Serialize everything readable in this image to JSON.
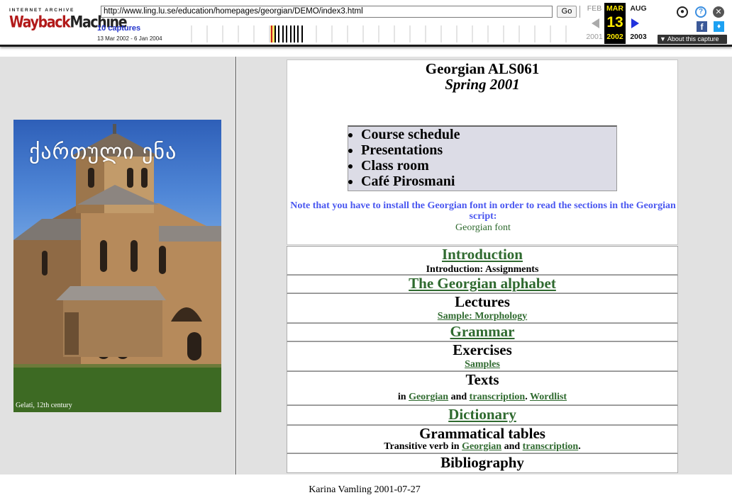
{
  "wayback": {
    "logo_top": "INTERNET ARCHIVE",
    "logo_way": "Wayback",
    "logo_machine": "Machine",
    "url": "http://www.ling.lu.se/education/homepages/georgian/DEMO/index3.html",
    "go_label": "Go",
    "captures": "10 captures",
    "range": "13 Mar 2002 - 6 Jan 2004",
    "months": {
      "prev": {
        "name": "FEB",
        "year": "2001"
      },
      "current": {
        "name": "MAR",
        "day": "13",
        "year": "2002"
      },
      "next": {
        "name": "AUG",
        "year": "2003"
      }
    },
    "about_label": "About this capture",
    "colors": {
      "current_bg": "#000000",
      "current_fg": "#ffea00",
      "captures_link": "#2233cc"
    }
  },
  "left_panel": {
    "image_title": "ქართული ენა",
    "image_caption": "Gelati, 12th century"
  },
  "header": {
    "title": "Georgian ALS061",
    "term": "Spring 2001",
    "menu": [
      "Course schedule",
      "Presentations",
      "Class room",
      "Café Pirosmani"
    ],
    "note": "Note that you have to install the Georgian font in order to read the sections in the Georgian script:",
    "font_link": "Georgian font"
  },
  "sections": {
    "introduction": {
      "title": "Introduction",
      "sub": "Introduction: Assignments"
    },
    "alphabet": {
      "title": "The Georgian alphabet"
    },
    "lectures": {
      "title": "Lectures",
      "sub_link": "Sample: Morphology"
    },
    "grammar": {
      "title": "Grammar"
    },
    "exercises": {
      "title": "Exercises",
      "sub_link": "Samples"
    },
    "texts": {
      "title": "Texts",
      "in": "in",
      "link1": "Georgian",
      "and": "and",
      "link2": "transcription",
      "dot": ".",
      "link3": "Wordlist"
    },
    "dictionary": {
      "title": "Dictionary"
    },
    "grammatical_tables": {
      "title": "Grammatical tables",
      "prefix": "Transitive verb in",
      "link1": "Georgian",
      "and": "and",
      "link2": "transcription",
      "dot": "."
    },
    "bibliography": {
      "title": "Bibliography"
    }
  },
  "footer": {
    "text": "Karina Vamling 2001-07-27"
  },
  "colors": {
    "link": "#2f6a2f",
    "note": "#4a57f0",
    "frame_bg": "#e1e1e1",
    "menu_bg": "#dcdce6"
  }
}
